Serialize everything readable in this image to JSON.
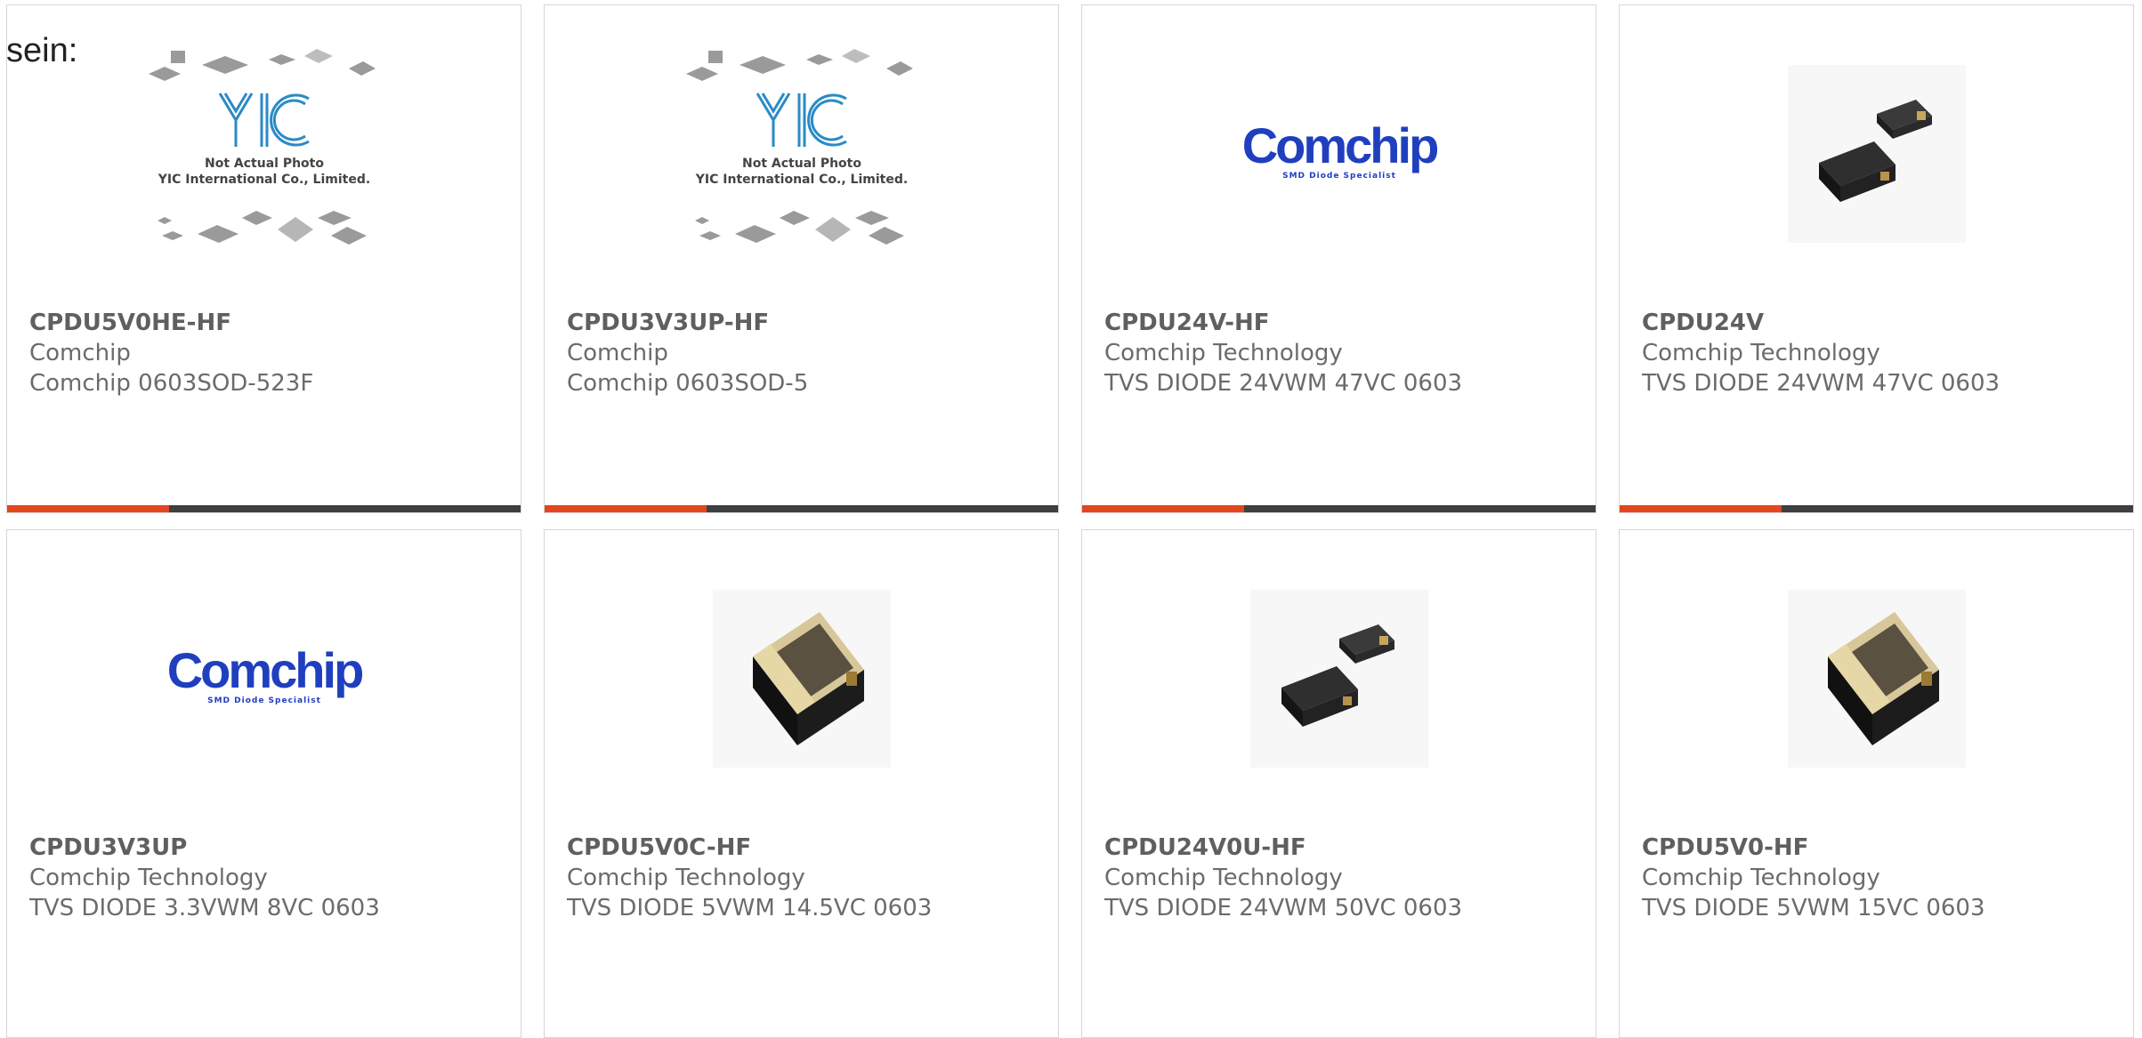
{
  "lead_text": "sein:",
  "colors": {
    "accent": "#e3451f",
    "bar": "#3f3f3f",
    "comchip_blue": "#1f3fbf",
    "yic_blue": "#2a8ac6"
  },
  "products": [
    {
      "part": "CPDU5V0HE-HF",
      "maker": "Comchip",
      "desc": "Comchip 0603SOD-523F",
      "image": "yic-not-actual-photo"
    },
    {
      "part": "CPDU3V3UP-HF",
      "maker": "Comchip",
      "desc": "Comchip 0603SOD-5",
      "image": "yic-not-actual-photo"
    },
    {
      "part": "CPDU24V-HF",
      "maker": "Comchip Technology",
      "desc": "TVS DIODE 24VWM 47VC 0603",
      "image": "comchip-logo"
    },
    {
      "part": "CPDU24V",
      "maker": "Comchip Technology",
      "desc": "TVS DIODE 24VWM 47VC 0603",
      "image": "two-black-chips"
    },
    {
      "part": "CPDU3V3UP",
      "maker": "Comchip Technology",
      "desc": "TVS DIODE 3.3VWM 8VC 0603",
      "image": "comchip-logo"
    },
    {
      "part": "CPDU5V0C-HF",
      "maker": "Comchip Technology",
      "desc": "TVS DIODE 5VWM 14.5VC 0603",
      "image": "single-chip-closeup"
    },
    {
      "part": "CPDU24V0U-HF",
      "maker": "Comchip Technology",
      "desc": "TVS DIODE 24VWM 50VC 0603",
      "image": "two-black-chips"
    },
    {
      "part": "CPDU5V0-HF",
      "maker": "Comchip Technology",
      "desc": "TVS DIODE 5VWM 15VC 0603",
      "image": "single-chip-closeup"
    }
  ],
  "yic_image_text": {
    "line1": "Not Actual Photo",
    "line2": "YIC International Co., Limited."
  },
  "comchip_logo_text": {
    "word": "Comchip",
    "tagline": "SMD Diode Specialist"
  }
}
